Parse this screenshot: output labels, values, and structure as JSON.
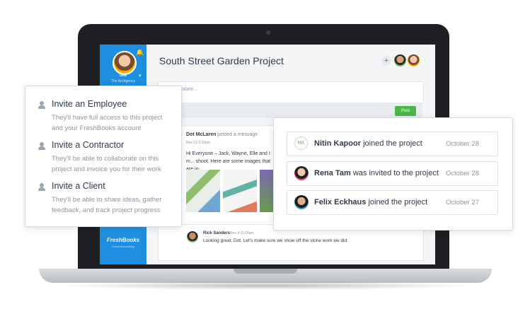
{
  "app": {
    "sidebar": {
      "user_name": "Dot",
      "agency": "The Art Agency",
      "logo": "FreshBooks",
      "logo_sub": "Cloud Accounting"
    },
    "project": {
      "title": "South Street Garden Project",
      "add_label": "+",
      "compose_placeholder": "update...",
      "post_label": "Post"
    },
    "message": {
      "author": "Dot McLaren",
      "action": "posted a message",
      "time": "Nov 13 3:20pm",
      "body": "Hi Everyone – Jack, Wayne, Elle and I m... shoot. Here are some images that are in-..."
    },
    "reply": {
      "author": "Rick Sanders",
      "time": "Nov 4 11:00am",
      "body": "Looking great, Dot. Let's make sure we show off the stone work we did."
    }
  },
  "invite_card": {
    "items": [
      {
        "title": "Invite an Employee",
        "desc": "They'll have full access to this project and your FreshBooks account",
        "icon": "person-icon"
      },
      {
        "title": "Invite a Contractor",
        "desc": "They'll be able to collaborate on this project and invoice you for their work",
        "icon": "person-icon"
      },
      {
        "title": "Invite a Client",
        "desc": "They'll be able to share ideas, gather feedback, and track project progress",
        "icon": "person-icon"
      }
    ]
  },
  "activity_card": {
    "items": [
      {
        "initials": "NK",
        "name": "Nitin Kapoor",
        "action": "joined the project",
        "date": "October 28"
      },
      {
        "name": "Rena Tam",
        "action": "was invited to the project",
        "date": "October 28"
      },
      {
        "name": "Felix Eckhaus",
        "action": "joined the project",
        "date": "October 27"
      }
    ]
  },
  "colors": {
    "sidebar_blue": "#1e8fe0",
    "post_green": "#4cb648",
    "text_dark": "#2f3a4a",
    "text_muted": "#8c95a0"
  }
}
